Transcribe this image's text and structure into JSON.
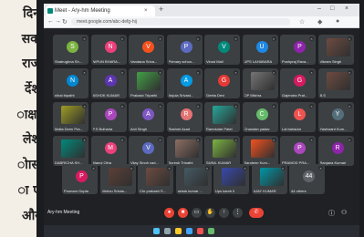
{
  "newspaper": {
    "words": [
      "दिन",
      "सक",
      "राज",
      "र्देश",
      "ाक्षा",
      "लेश",
      "ोास",
      "ा ए",
      "और"
    ]
  },
  "browser": {
    "tab_title": "Meet - Ary-hm Meeting",
    "tab_close": "×",
    "new_tab": "+",
    "url": "meet.google.com/abc-defg-hij",
    "window_controls": [
      "–",
      "□",
      "×"
    ]
  },
  "meeting": {
    "title": "Ary-hm Meeting",
    "participants": [
      {
        "name": "Shatrughna Sh...",
        "initial": "S",
        "color": "#7cb342",
        "photo": false
      },
      {
        "name": "NIPUN BHARA...",
        "initial": "N",
        "color": "#ec407a",
        "photo": false
      },
      {
        "name": "Vandana Sriva...",
        "initial": "V",
        "color": "#f4511e",
        "photo": false
      },
      {
        "name": "Primary schoo...",
        "initial": "P",
        "color": "#5c6bc0",
        "photo": false
      },
      {
        "name": "Vinod Mall",
        "initial": "V",
        "color": "#00897b",
        "photo": false
      },
      {
        "name": "UPS LAHABARA",
        "initial": "U",
        "color": "#1e88e5",
        "photo": false
      },
      {
        "name": "Pushpraj Rava...",
        "initial": "P",
        "color": "#8e24aa",
        "photo": false
      },
      {
        "name": "Vikram Singh",
        "initial": "V",
        "color": "#6d4c41",
        "photo": true
      },
      {
        "name": "nihal tripathi",
        "initial": "N",
        "color": "#0288d1",
        "photo": false
      },
      {
        "name": "ASHOK KUMAR",
        "initial": "A",
        "color": "#5e35b1",
        "photo": false
      },
      {
        "name": "Prakash Tripathi",
        "initial": "P",
        "color": "#43a047",
        "photo": true
      },
      {
        "name": "Anjula Srivast...",
        "initial": "A",
        "color": "#039be5",
        "photo": false
      },
      {
        "name": "Geeta Devi",
        "initial": "G",
        "color": "#e53935",
        "photo": false
      },
      {
        "name": "OP Mishra",
        "initial": "O",
        "color": "#757575",
        "photo": true
      },
      {
        "name": "Gajendra Prat...",
        "initial": "G",
        "color": "#d81b60",
        "photo": false
      },
      {
        "name": "B.S",
        "initial": "B",
        "color": "#6d4c41",
        "photo": true
      },
      {
        "name": "Malla Deen Pra...",
        "initial": "M",
        "color": "#9e9d24",
        "photo": true
      },
      {
        "name": "P.S Bulharia",
        "initial": "P",
        "color": "#ab47bc",
        "photo": false
      },
      {
        "name": "Anil Singh",
        "initial": "A",
        "color": "#7e57c2",
        "photo": false
      },
      {
        "name": "Rashmi Azad",
        "initial": "R",
        "color": "#e57373",
        "photo": false
      },
      {
        "name": "Ramdulari Patel",
        "initial": "R",
        "color": "#26a69a",
        "photo": true
      },
      {
        "name": "Chandan yadav",
        "initial": "C",
        "color": "#66bb6a",
        "photo": false
      },
      {
        "name": "Lal bahadur",
        "initial": "L",
        "color": "#ef5350",
        "photo": false
      },
      {
        "name": "Yashwant Kum...",
        "initial": "Y",
        "color": "#546e7a",
        "photo": false
      },
      {
        "name": "DABRICHA SH...",
        "initial": "D",
        "color": "#00897b",
        "photo": true
      },
      {
        "name": "Manoj Ojha",
        "initial": "M",
        "color": "#ec407a",
        "photo": false
      },
      {
        "name": "Vijay Singh yad...",
        "initial": "V",
        "color": "#5c6bc0",
        "photo": false
      },
      {
        "name": "Suresh Tripathi",
        "initial": "S",
        "color": "#8d6e63",
        "photo": true
      },
      {
        "name": "SUNIL KUMAR",
        "initial": "S",
        "color": "#7cb342",
        "photo": true
      },
      {
        "name": "Sandeep Kum...",
        "initial": "S",
        "color": "#f4511e",
        "photo": true
      },
      {
        "name": "PRAMOD PRA...",
        "initial": "P",
        "color": "#ab47bc",
        "photo": false
      },
      {
        "name": "Ranjana Kumari",
        "initial": "R",
        "color": "#8e24aa",
        "photo": false
      },
      {
        "name": "Poonam Gupta",
        "initial": "P",
        "color": "#d81b60",
        "photo": false
      },
      {
        "name": "Vishnu Srivas...",
        "initial": "V",
        "color": "#5d4037",
        "photo": true
      },
      {
        "name": "Chr prakash S...",
        "initial": "C",
        "color": "#6d4c41",
        "photo": true
      },
      {
        "name": "ashok kumar ...",
        "initial": "A",
        "color": "#455a64",
        "photo": true
      },
      {
        "name": "Ups kamh II",
        "initial": "U",
        "color": "#3949ab",
        "photo": true
      },
      {
        "name": "AJAY KUMAR",
        "initial": "A",
        "color": "#0097a7",
        "photo": true
      },
      {
        "name": "44 others",
        "initial": "44",
        "color": "#5f6368",
        "photo": false
      }
    ],
    "controls": [
      "mic-off",
      "camera-off",
      "captions",
      "raise-hand",
      "present",
      "more",
      "end-call"
    ]
  }
}
